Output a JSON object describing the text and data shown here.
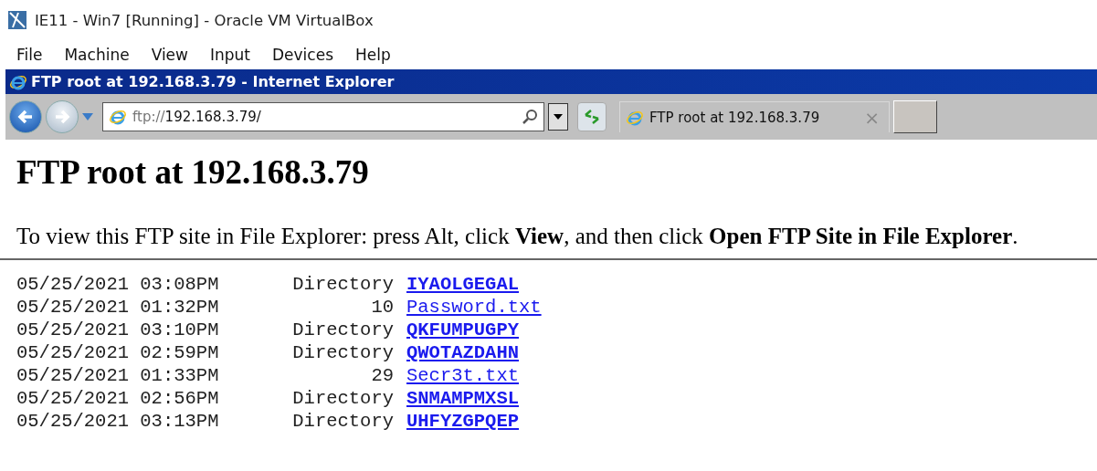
{
  "window": {
    "title": "IE11 - Win7 [Running] - Oracle VM VirtualBox"
  },
  "menu": [
    "File",
    "Machine",
    "View",
    "Input",
    "Devices",
    "Help"
  ],
  "browser": {
    "title": "FTP root at 192.168.3.79 - Internet Explorer",
    "address": {
      "scheme": "ftp://",
      "host": "192.168.3.79/"
    },
    "tab": {
      "label": "FTP root at 192.168.3.79",
      "close": "×"
    }
  },
  "page": {
    "heading": "FTP root at 192.168.3.79",
    "instruction": "To view this FTP site in File Explorer: press Alt, click **View**, and then click **Open FTP Site in File Explorer**.",
    "listing": [
      {
        "date": "05/25/2021 03:08PM",
        "size": "Directory",
        "name": "IYAOLGEGAL",
        "kind": "directory"
      },
      {
        "date": "05/25/2021 01:32PM",
        "size": "10",
        "name": "Password.txt",
        "kind": "file"
      },
      {
        "date": "05/25/2021 03:10PM",
        "size": "Directory",
        "name": "QKFUMPUGPY",
        "kind": "directory"
      },
      {
        "date": "05/25/2021 02:59PM",
        "size": "Directory",
        "name": "QWOTAZDAHN",
        "kind": "directory"
      },
      {
        "date": "05/25/2021 01:33PM",
        "size": "29",
        "name": "Secr3t.txt",
        "kind": "file"
      },
      {
        "date": "05/25/2021 02:56PM",
        "size": "Directory",
        "name": "SNMAMPMXSL",
        "kind": "directory"
      },
      {
        "date": "05/25/2021 03:13PM",
        "size": "Directory",
        "name": "UHFYZGPQEP",
        "kind": "directory"
      }
    ]
  }
}
